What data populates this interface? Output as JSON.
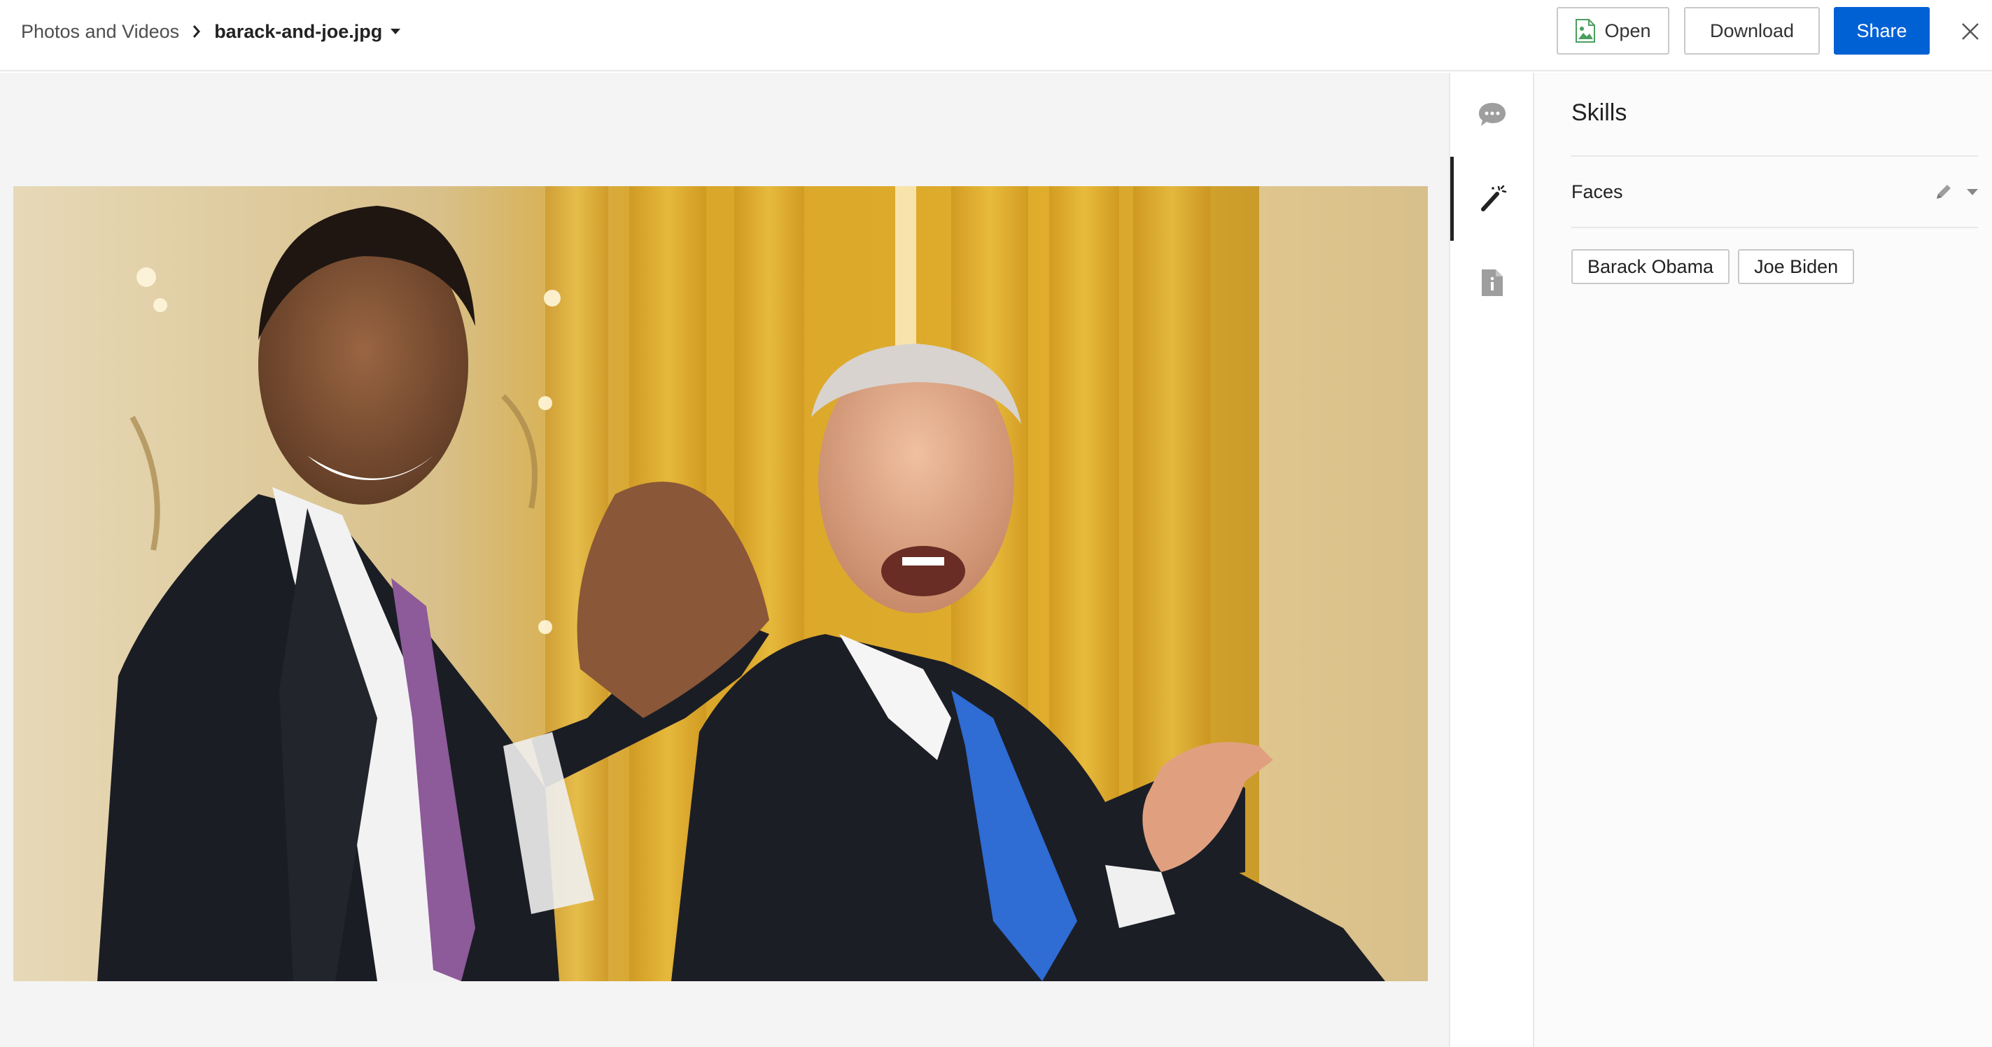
{
  "breadcrumb": {
    "parent": "Photos and Videos",
    "file": "barack-and-joe.jpg"
  },
  "toolbar": {
    "open_label": "Open",
    "download_label": "Download",
    "share_label": "Share"
  },
  "colors": {
    "accent": "#0061d5",
    "preview_bg": "#f4f4f4",
    "sidebar_bg": "#fbfbfb"
  },
  "icons": {
    "nav": [
      "comment-icon",
      "magic-wand-icon",
      "info-document-icon"
    ],
    "toolbar": [
      "image-file-icon",
      "close-icon"
    ],
    "faces": [
      "pencil-icon",
      "caret-down-icon"
    ]
  },
  "sidebar": {
    "title": "Skills",
    "section": {
      "label": "Faces",
      "tags": [
        "Barack Obama",
        "Joe Biden"
      ]
    }
  }
}
